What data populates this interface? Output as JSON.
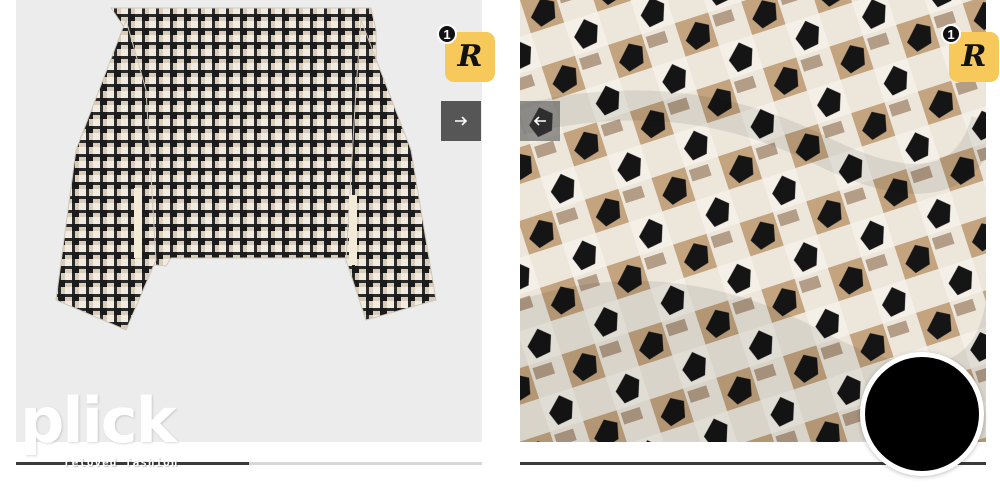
{
  "gallery": {
    "left_panel": {
      "image": "houndstooth-sweater-product-photo",
      "background": "#ececec",
      "badge": {
        "count": "1",
        "letter": "R",
        "color": "#f7c85a"
      },
      "next_arrow_icon": "arrow-right-icon",
      "progress": 0.5
    },
    "right_panel": {
      "image": "houndstooth-knit-closeup-photo",
      "badge": {
        "count": "1",
        "letter": "R",
        "color": "#f7c85a"
      },
      "prev_arrow_icon": "arrow-left-icon",
      "progress": 1.0
    }
  },
  "watermark": {
    "word": "plick",
    "tagline": "reloved fashion"
  },
  "fab": {
    "color": "#000000"
  }
}
